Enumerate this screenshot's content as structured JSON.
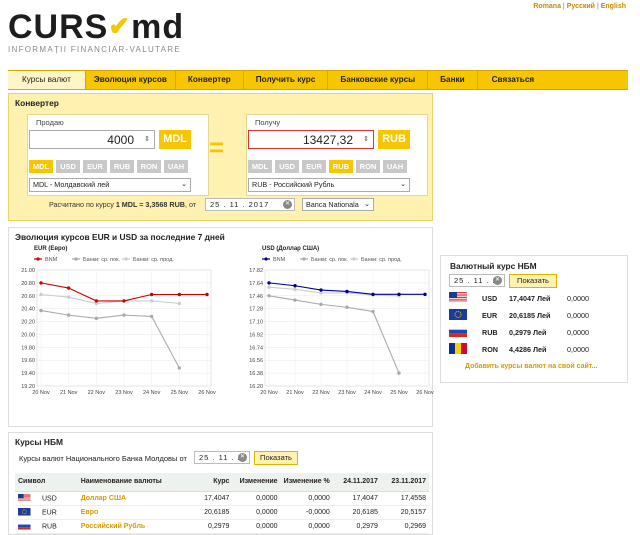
{
  "logo": {
    "main": "CURS",
    "suffix": "md",
    "tagline": "INFORMAȚII FINANCIAR-VALUTARE"
  },
  "languages": [
    "Romana",
    "Русский",
    "English"
  ],
  "nav": [
    "Курсы валют",
    "Эволюция курсов",
    "Конвертер",
    "Получить курс",
    "Банковские курсы",
    "Банки",
    "Связаться"
  ],
  "converter": {
    "title": "Конвертер",
    "from": {
      "label": "Продаю",
      "amount": "4000",
      "currency": "MDL",
      "select": "MDL - Молдавский лей"
    },
    "to": {
      "label": "Получу",
      "amount": "13427,32",
      "currency": "RUB",
      "select": "RUB - Российский Рубль"
    },
    "currencies": [
      "MDL",
      "USD",
      "EUR",
      "RUB",
      "RON",
      "UAH"
    ],
    "rate_text_pre": "Расчитано по курсу",
    "rate_text_bold": "1 MDL = 3,3568 RUB",
    "rate_text_post": ", от",
    "date": "25 . 11 . 2017",
    "bank": "Banca Nationala"
  },
  "evolution": {
    "title": "Эволюция курсов EUR и USD за последние 7 дней",
    "legend": [
      "BNM",
      "Банки: ср. пок.",
      "Банки: ср. прод."
    ]
  },
  "chart_data": [
    {
      "type": "line",
      "title": "EUR (Евро)",
      "categories": [
        "20 Nov",
        "21 Nov",
        "22 Nov",
        "23 Nov",
        "24 Nov",
        "25 Nov",
        "26 Nov"
      ],
      "ylim": [
        19.2,
        21.0
      ],
      "yticks": [
        "21.00",
        "20.80",
        "20.60",
        "20.40",
        "20.20",
        "20.00",
        "19.80",
        "19.60",
        "19.40",
        "19.20"
      ],
      "series": [
        {
          "name": "BNM",
          "color": "#cc0000",
          "values": [
            20.8,
            20.72,
            20.52,
            20.52,
            20.62,
            20.62,
            20.62
          ]
        },
        {
          "name": "Банки: ср. пок.",
          "color": "#aaaaaa",
          "values": [
            20.37,
            20.3,
            20.25,
            20.3,
            20.28,
            19.48,
            null
          ]
        },
        {
          "name": "Банки: ср. прод.",
          "color": "#cccccc",
          "values": [
            20.62,
            20.58,
            20.48,
            20.52,
            20.52,
            20.48,
            null
          ]
        }
      ]
    },
    {
      "type": "line",
      "title": "USD (Доллар США)",
      "categories": [
        "20 Nov",
        "21 Nov",
        "22 Nov",
        "23 Nov",
        "24 Nov",
        "25 Nov",
        "26 Nov"
      ],
      "ylim": [
        16.26,
        17.82
      ],
      "yticks": [
        "17.82",
        "17.64",
        "17.46",
        "17.28",
        "17.10",
        "16.92",
        "16.74",
        "16.56",
        "16.38",
        "16.20"
      ],
      "series": [
        {
          "name": "BNM",
          "color": "#000099",
          "values": [
            17.64,
            17.6,
            17.54,
            17.52,
            17.48,
            17.48,
            17.48
          ]
        },
        {
          "name": "Банки: ср. пок.",
          "color": "#aaaaaa",
          "values": [
            17.46,
            17.4,
            17.34,
            17.3,
            17.24,
            16.38,
            null
          ]
        },
        {
          "name": "Банки: ср. прод.",
          "color": "#cccccc",
          "values": [
            17.58,
            17.55,
            17.5,
            17.5,
            17.47,
            17.46,
            null
          ]
        }
      ]
    }
  ],
  "nbm_side": {
    "title": "Валютный курс НБМ",
    "date": "25 . 11 . 2",
    "button": "Показать",
    "rows": [
      {
        "code": "USD",
        "value": "17,4047 Лей",
        "change": "0,0000",
        "flag": "us"
      },
      {
        "code": "EUR",
        "value": "20,6185 Лей",
        "change": "0,0000",
        "flag": "eu"
      },
      {
        "code": "RUB",
        "value": "0,2979 Лей",
        "change": "0,0000",
        "flag": "ru"
      },
      {
        "code": "RON",
        "value": "4,4286 Лей",
        "change": "0,0000",
        "flag": "ro"
      }
    ],
    "add_link": "Добавить курсы валют на свой сайт..."
  },
  "kursy": {
    "title": "Курсы НБМ",
    "subtitle": "Курсы валют Национального Банка Молдовы от",
    "date": "25 . 11 . 2",
    "button": "Показать",
    "columns": [
      "Символ",
      "Наименование валюты",
      "Курс",
      "Изменение",
      "Изменение %",
      "24.11.2017",
      "23.11.2017"
    ],
    "rows": [
      {
        "code": "USD",
        "name": "Доллар США",
        "rate": "17,4047",
        "change": "0,0000",
        "pct": "0,0000",
        "d1": "17,4047",
        "d2": "17,4558",
        "flag": "us"
      },
      {
        "code": "EUR",
        "name": "Евро",
        "rate": "20,6185",
        "change": "0,0000",
        "pct": "-0,0000",
        "d1": "20,6185",
        "d2": "20,5157",
        "flag": "eu"
      },
      {
        "code": "RUB",
        "name": "Российский Рубль",
        "rate": "0,2979",
        "change": "0,0000",
        "pct": "0,0000",
        "d1": "0,2979",
        "d2": "0,2969",
        "flag": "ru"
      }
    ]
  }
}
